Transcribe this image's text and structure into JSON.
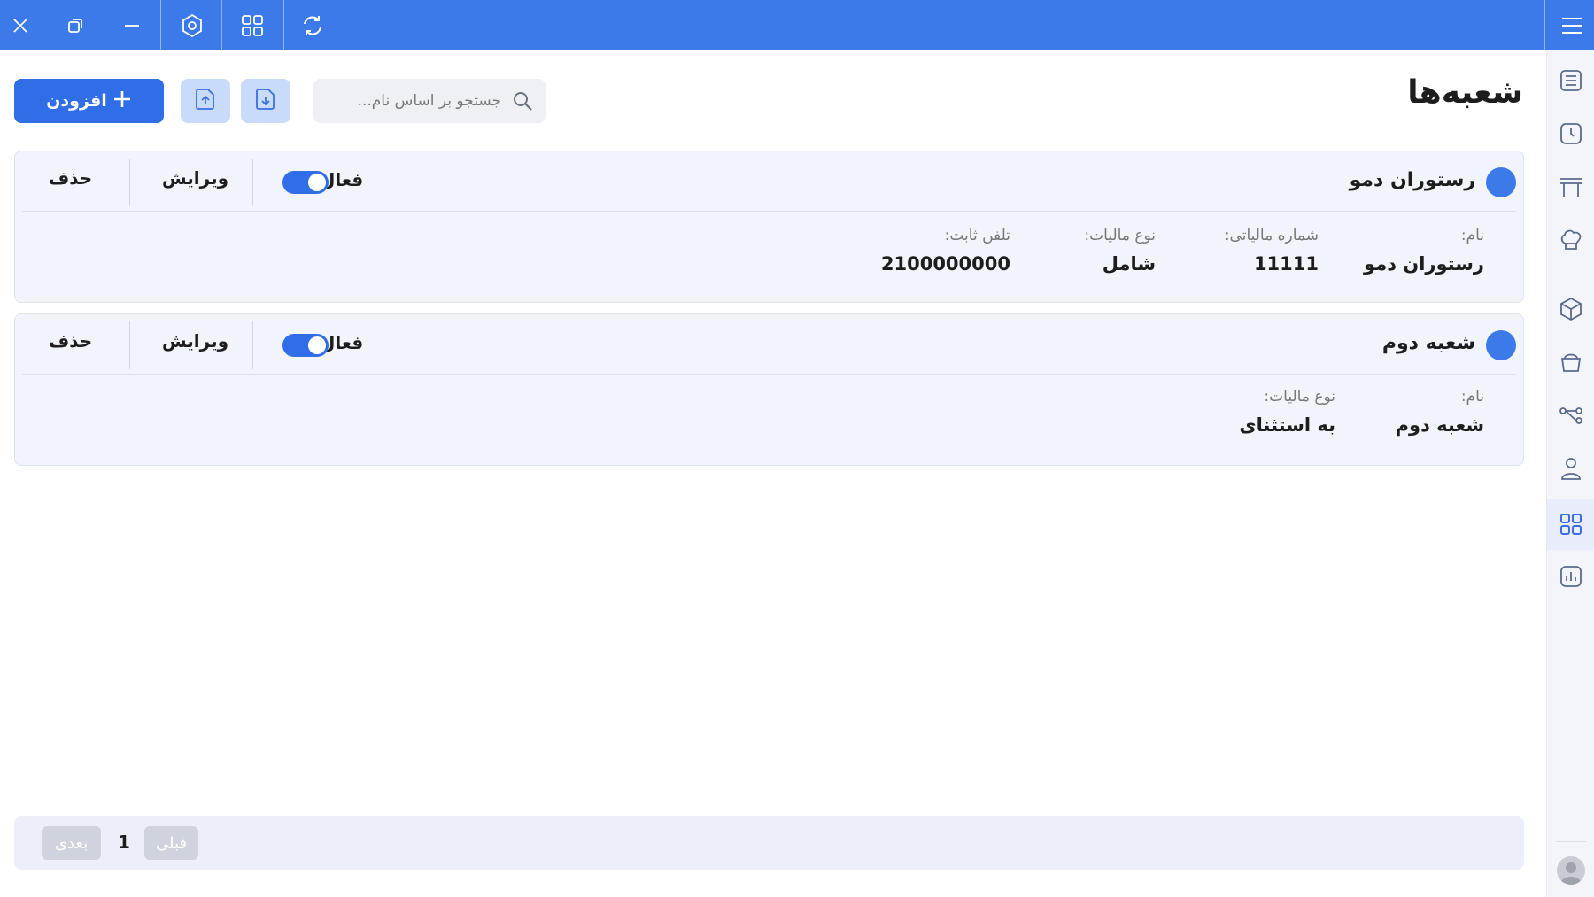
{
  "window": {
    "buttons": [
      "close-icon",
      "restore-icon",
      "minimize-icon",
      "settings-icon",
      "grid-icon",
      "refresh-icon",
      "menu-icon"
    ]
  },
  "sidebar": {
    "items": [
      {
        "icon": "list-icon",
        "active": false
      },
      {
        "icon": "clock-icon",
        "active": false
      },
      {
        "icon": "table-icon",
        "active": false
      },
      {
        "icon": "chef-hat-icon",
        "active": false
      },
      {
        "icon": "box-icon",
        "active": false
      },
      {
        "icon": "basket-icon",
        "active": false
      },
      {
        "icon": "flow-icon",
        "active": false
      },
      {
        "icon": "user-icon",
        "active": false
      },
      {
        "icon": "branches-icon",
        "active": true
      },
      {
        "icon": "chart-icon",
        "active": false
      }
    ]
  },
  "header": {
    "title": "شعبه‌ها",
    "search_placeholder": "جستجو بر اساس نام...",
    "add_label": "افزودن"
  },
  "branches": [
    {
      "name": "رستوران دمو",
      "status_label": "فعال",
      "active": true,
      "edit_label": "ویرایش",
      "delete_label": "حذف",
      "fields": [
        {
          "label": "نام:",
          "value": "رستوران دمو"
        },
        {
          "label": "شماره مالیاتی:",
          "value": "11111"
        },
        {
          "label": "نوع مالیات:",
          "value": "شامل"
        },
        {
          "label": "تلفن ثابت:",
          "value": "2100000000"
        }
      ]
    },
    {
      "name": "شعبه دوم",
      "status_label": "فعال",
      "active": true,
      "edit_label": "ویرایش",
      "delete_label": "حذف",
      "fields": [
        {
          "label": "نام:",
          "value": "شعبه دوم"
        },
        {
          "label": "نوع مالیات:",
          "value": "به استثنای"
        }
      ]
    }
  ],
  "pagination": {
    "prev_label": "قبلی",
    "page": "1",
    "next_label": "بعدی"
  },
  "colors": {
    "accent": "#3b7ae8",
    "primary_button": "#2f6ee6",
    "card_background": "#f2f4fb"
  }
}
